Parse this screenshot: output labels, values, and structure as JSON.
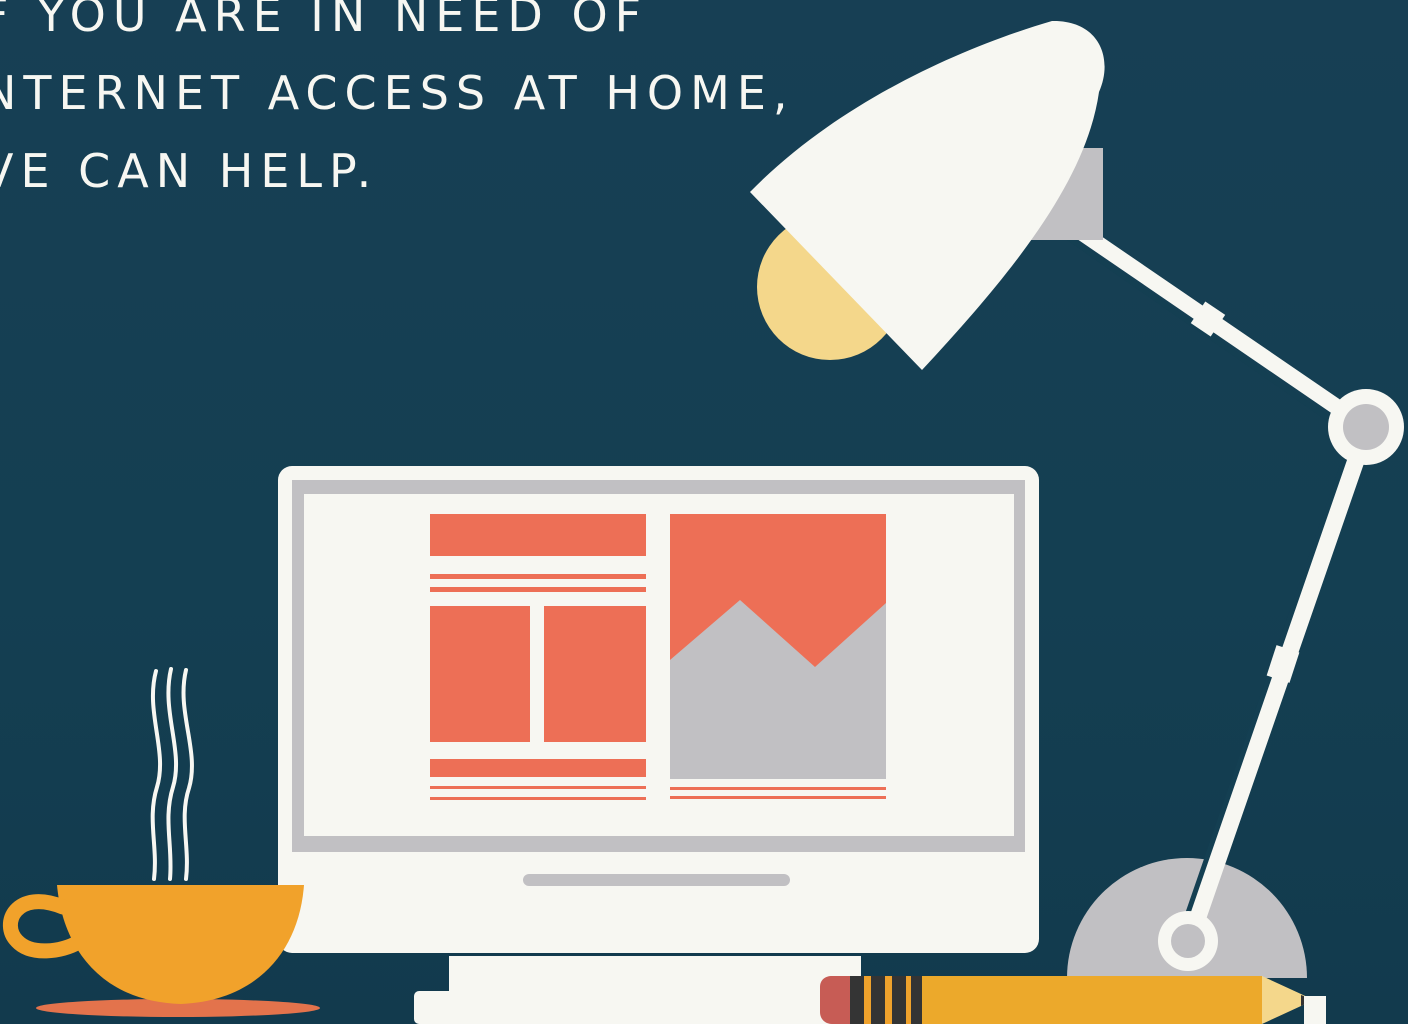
{
  "headline": {
    "line_1": "F YOU ARE IN NEED OF",
    "line_2": "NTERNET ACCESS AT HOME,",
    "line_3": "VE CAN HELP."
  },
  "colors": {
    "background": "#143f52",
    "white": "#f7f7f2",
    "gray": "#bfbfc1",
    "coral": "#ed6f56",
    "orange": "#f1a22b",
    "bulb": "#f4d78b",
    "pencil": "#eca92b",
    "dark": "#343434"
  },
  "icons": {
    "desk_lamp": "desk-lamp-icon",
    "computer_monitor": "computer-monitor-icon",
    "coffee_cup": "coffee-cup-icon",
    "pencil": "pencil-icon"
  }
}
